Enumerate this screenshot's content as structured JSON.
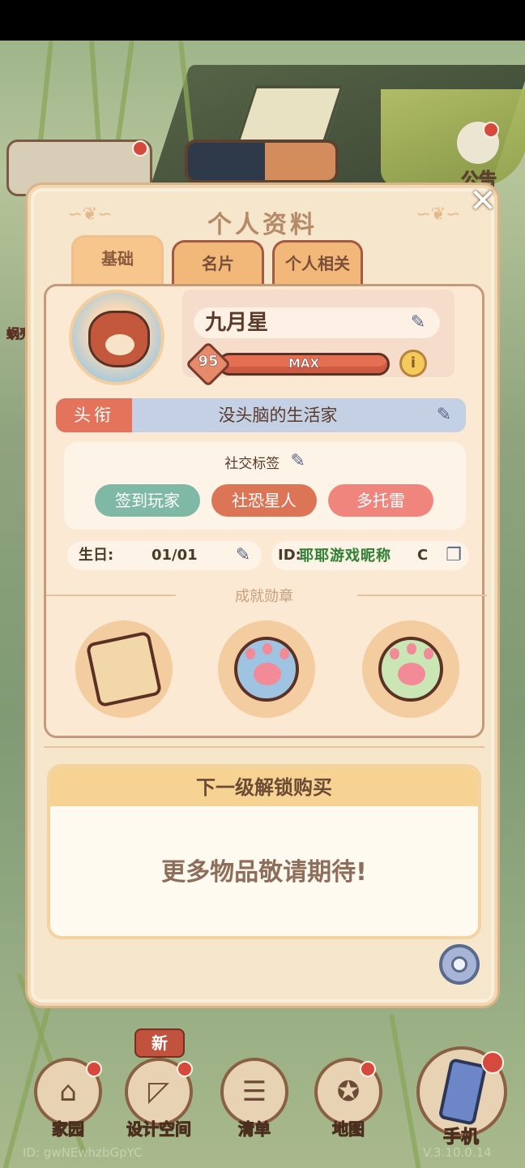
{
  "hud": {
    "notice_label": "公告",
    "left_side_label": "蜗壳"
  },
  "panel": {
    "title": "个人资料",
    "close_symbol": "✕",
    "tabs": [
      {
        "label": "基础",
        "active": true
      },
      {
        "label": "名片",
        "active": false
      },
      {
        "label": "个人相关",
        "active": false
      }
    ]
  },
  "profile": {
    "name": "九月星",
    "level": "95",
    "level_bar_text": "MAX",
    "level_progress": 1.0,
    "info_symbol": "i",
    "title_label": "头衔",
    "title_value": "没头脑的生活家",
    "social_tags_title": "社交标签",
    "social_tags": [
      {
        "label": "签到玩家",
        "color": "#7fb9a6"
      },
      {
        "label": "社恐星人",
        "color": "#dc7456"
      },
      {
        "label": "多托雷",
        "color": "#f0857d"
      }
    ],
    "birthday_label": "生日:",
    "birthday_value": "01/01",
    "id_label": "ID:",
    "id_tail": "C",
    "nickname_overlay": "耶耶游戏昵称"
  },
  "achievements": {
    "title": "成就勋章"
  },
  "unlock": {
    "header": "下一级解锁购买",
    "message": "更多物品敬请期待!"
  },
  "nav": {
    "new_badge": "新",
    "items": [
      {
        "label": "家园",
        "icon": "house-icon"
      },
      {
        "label": "设计空间",
        "icon": "ruler-icon"
      },
      {
        "label": "清单",
        "icon": "list-icon"
      },
      {
        "label": "地图",
        "icon": "owl-map-icon"
      }
    ],
    "phone_label": "手机"
  },
  "footer": {
    "id_text": "ID: gwNEwhzbGpYC",
    "version_text": "V.3.10.0.14"
  },
  "colors": {
    "accent_red": "#d6493d",
    "panel_bg": "#f6e6cc",
    "title_label_bg": "#e4735b"
  }
}
